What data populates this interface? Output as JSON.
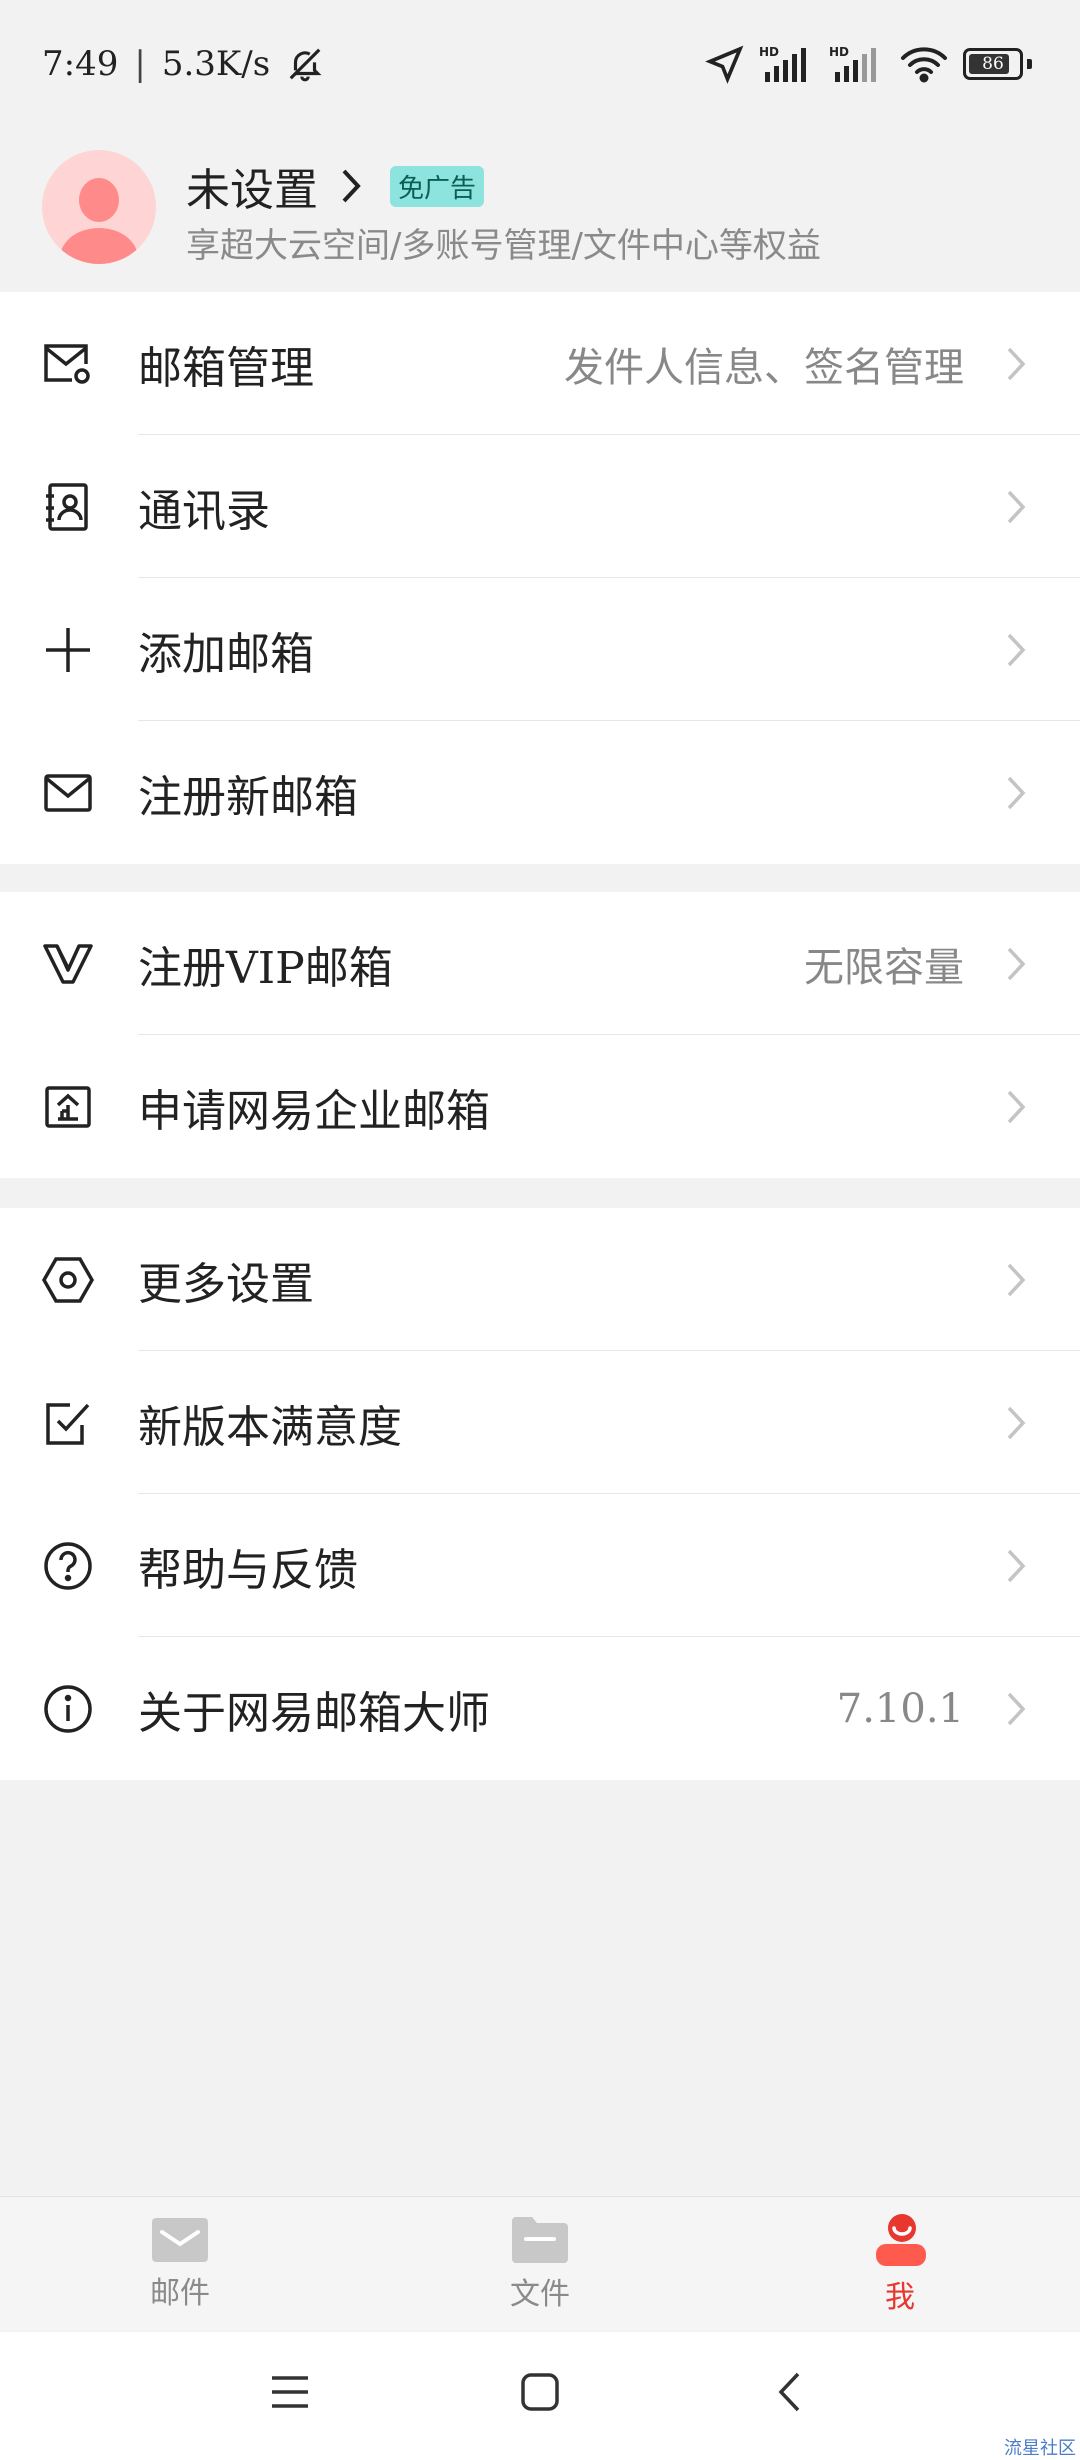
{
  "status_bar": {
    "time": "7:49",
    "separator": "|",
    "net_speed": "5.3K/s",
    "battery": "86"
  },
  "profile": {
    "name": "未设置",
    "badge": "免广告",
    "subtitle": "享超大云空间/多账号管理/文件中心等权益"
  },
  "groups": [
    {
      "items": [
        {
          "label": "邮箱管理",
          "value": "发件人信息、签名管理",
          "icon": "mail-settings-icon"
        },
        {
          "label": "通讯录",
          "value": "",
          "icon": "contacts-icon"
        },
        {
          "label": "添加邮箱",
          "value": "",
          "icon": "plus-icon"
        },
        {
          "label": "注册新邮箱",
          "value": "",
          "icon": "mail-icon"
        }
      ]
    },
    {
      "items": [
        {
          "label": "注册VIP邮箱",
          "value": "无限容量",
          "icon": "vip-icon"
        },
        {
          "label": "申请网易企业邮箱",
          "value": "",
          "icon": "enterprise-icon"
        }
      ]
    },
    {
      "items": [
        {
          "label": "更多设置",
          "value": "",
          "icon": "hexagon-settings-icon"
        },
        {
          "label": "新版本满意度",
          "value": "",
          "icon": "checkbox-icon"
        },
        {
          "label": "帮助与反馈",
          "value": "",
          "icon": "help-icon"
        },
        {
          "label": "关于网易邮箱大师",
          "value": "7.10.1",
          "icon": "info-icon"
        }
      ]
    }
  ],
  "tabs": [
    {
      "label": "邮件",
      "icon": "mail-tab-icon"
    },
    {
      "label": "文件",
      "icon": "folder-tab-icon"
    },
    {
      "label": "我",
      "icon": "me-tab-icon"
    }
  ],
  "colors": {
    "accent": "#e8372f",
    "badge_bg": "#8de3dd",
    "avatar": "#ff8a8a"
  },
  "watermark": "流星社区"
}
